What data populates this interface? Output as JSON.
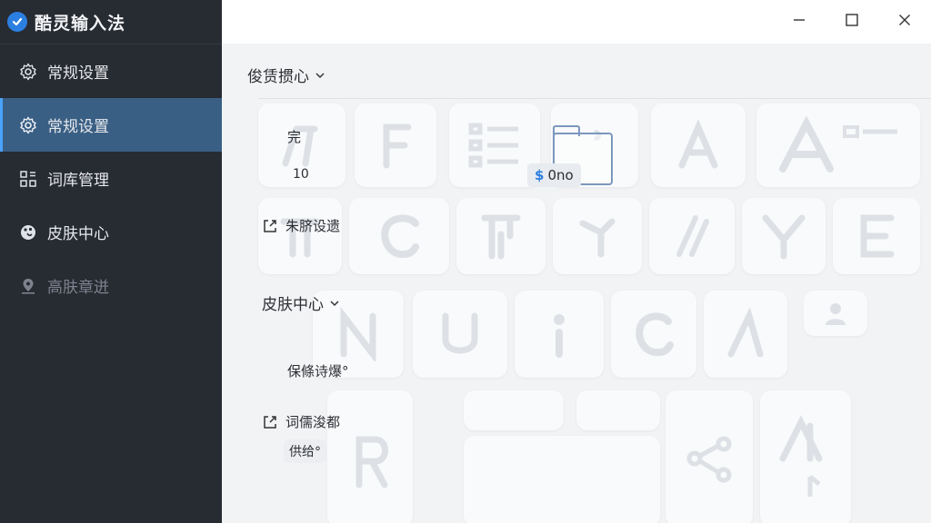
{
  "app": {
    "name": "酷灵输入法"
  },
  "sidebar": {
    "items": [
      {
        "label": "常规设置",
        "icon": "gear-icon"
      },
      {
        "label": "常规设置",
        "icon": "gear-icon"
      },
      {
        "label": "词库管理",
        "icon": "grid-icon"
      },
      {
        "label": "皮肤中心",
        "icon": "palette-icon"
      },
      {
        "label": "高肤章迸",
        "icon": "pin-icon"
      }
    ]
  },
  "main": {
    "section_title": "俊赁掼心",
    "field_label": "完",
    "field_value": "10",
    "badge_text": "0no",
    "link1": "朱脐设遗",
    "subsection_title": "皮肤中心",
    "text1": "保條诗爆°",
    "link2": "词儒浚都",
    "pill": "供给°"
  },
  "colors": {
    "accent": "#2b7fe0",
    "sidebar_bg": "#272b32",
    "active_bg": "#3a5f85"
  }
}
